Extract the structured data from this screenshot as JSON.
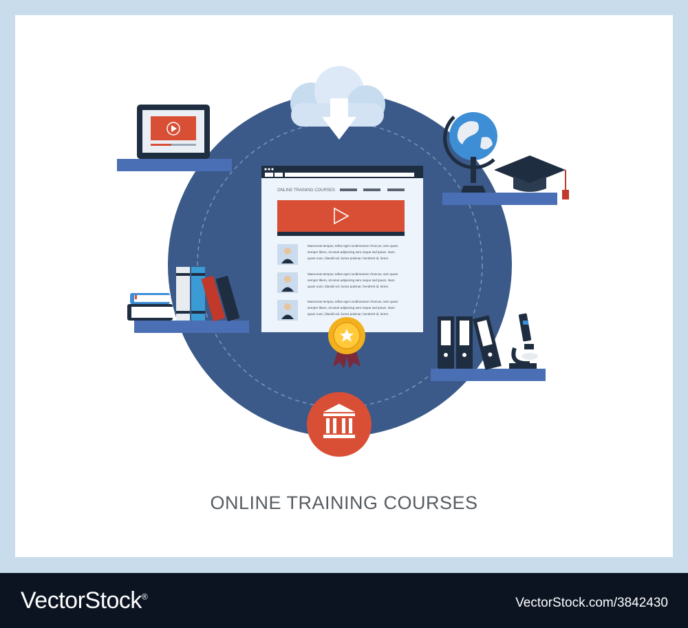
{
  "caption": "ONLINE TRAINING COURSES",
  "browser": {
    "header_label": "ONLINE TRAINING COURSES",
    "lines": [
      "Maecenas tempus, tellus eget condimentum rhoncus, sem quam",
      "semper libero, sit amet adipiscing sem neque sed ipsum. Nam",
      "quam nunc, blandit vel, luctus pulvinar, hendrerit id, lorem."
    ]
  },
  "footer": {
    "brand": "VectorStock",
    "brand_mark": "®",
    "ref": "VectorStock.com/3842430"
  },
  "icons": {
    "cloud": "cloud-download-icon",
    "tablet": "video-tablet-icon",
    "globe": "globe-icon",
    "cap": "graduation-cap-icon",
    "books": "books-icon",
    "folders": "binder-folders-icon",
    "microscope": "microscope-icon",
    "medal": "award-medal-icon",
    "building": "university-building-icon"
  },
  "colors": {
    "background": "#c8dcec",
    "circle": "#3b5a89",
    "accent_red": "#d94f36",
    "shelf": "#4a6fb5",
    "footer": "#0c1422"
  }
}
